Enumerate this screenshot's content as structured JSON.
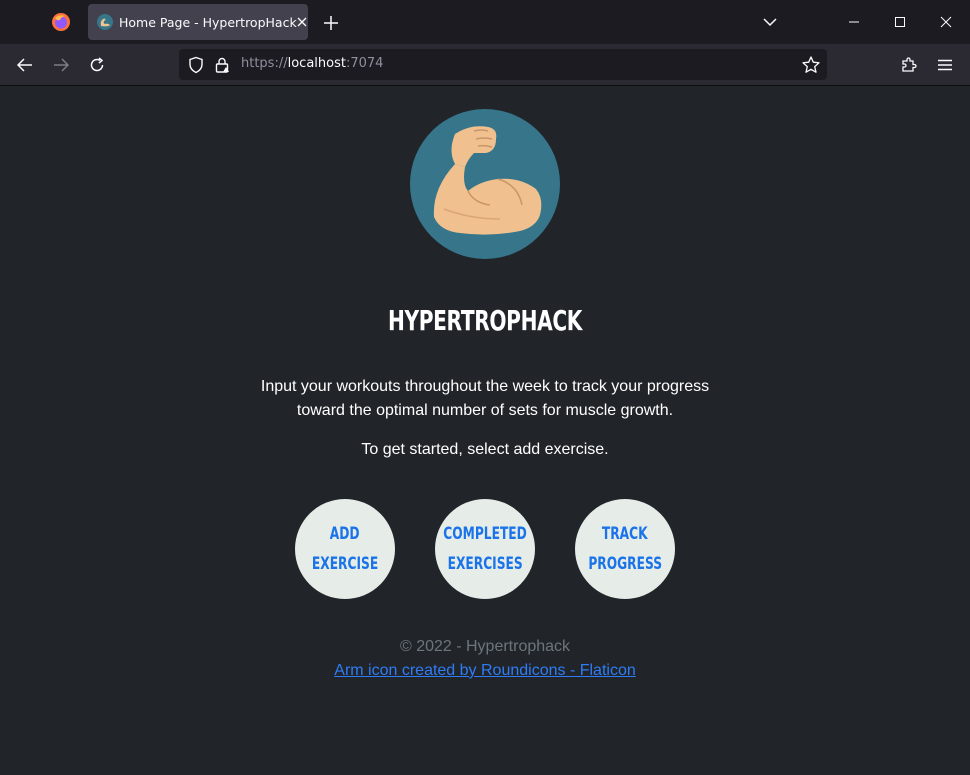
{
  "browser": {
    "tab": {
      "title": "Home Page - HypertropHack",
      "favicon": "arm-favicon"
    },
    "url": {
      "scheme": "https://",
      "host": "localhost",
      "port": ":7074"
    },
    "icons": {
      "app": "firefox-icon",
      "close_tab": "close-icon",
      "new_tab": "plus-icon",
      "tab_list": "chevron-down-icon",
      "minimize": "minimize-icon",
      "maximize": "maximize-icon",
      "close_window": "close-icon",
      "back": "back-arrow-icon",
      "forward": "forward-arrow-icon",
      "reload": "reload-icon",
      "shield": "shield-icon",
      "lock": "lock-icon",
      "bookmark": "star-icon",
      "extensions": "puzzle-icon",
      "menu": "hamburger-menu-icon"
    }
  },
  "page": {
    "logo_icon": "flexed-arm-icon",
    "title": "HYPERTROPHACK",
    "intro": "Input your workouts throughout the week to track your progress toward the optimal number of sets for muscle growth.",
    "instruction": "To get started, select add exercise.",
    "buttons": [
      {
        "line1": "ADD",
        "line2": "EXERCISE"
      },
      {
        "line1": "COMPLETED",
        "line2": "EXERCISES"
      },
      {
        "line1": "TRACK",
        "line2": "PROGRESS"
      }
    ],
    "footer": {
      "copyright": "© 2022 - Hypertrophack",
      "credit_link": "Arm icon created by Roundicons - Flaticon"
    }
  },
  "colors": {
    "page_bg": "#212529",
    "logo_bg": "#37768a",
    "button_bg": "#e6ede8",
    "button_text": "#1a73e8",
    "link": "#2f7cf6",
    "muted": "#6c757d"
  }
}
